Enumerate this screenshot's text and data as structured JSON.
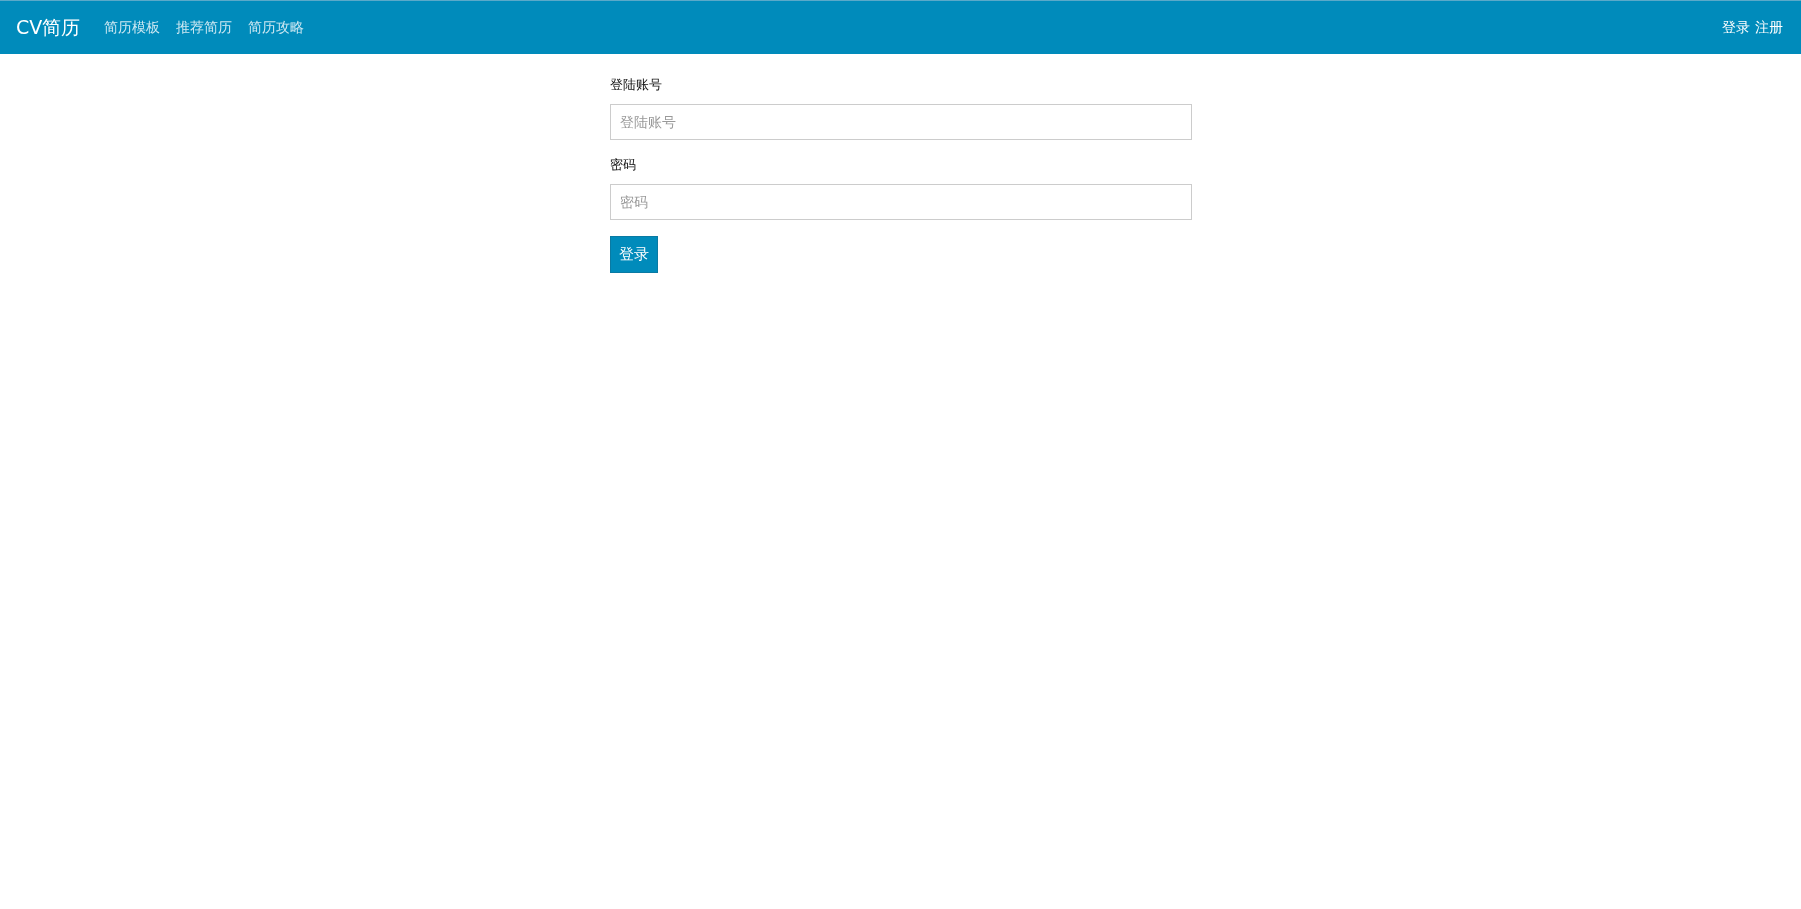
{
  "navbar": {
    "brand": "CV简历",
    "links": [
      {
        "label": "简历模板"
      },
      {
        "label": "推荐简历"
      },
      {
        "label": "简历攻略"
      }
    ],
    "account_links": [
      {
        "label": "登录"
      },
      {
        "label": "注册"
      }
    ]
  },
  "form": {
    "fields": [
      {
        "label": "登陆账号",
        "placeholder": "登陆账号"
      },
      {
        "label": "密码",
        "placeholder": "密码"
      }
    ],
    "submit": "登录"
  }
}
